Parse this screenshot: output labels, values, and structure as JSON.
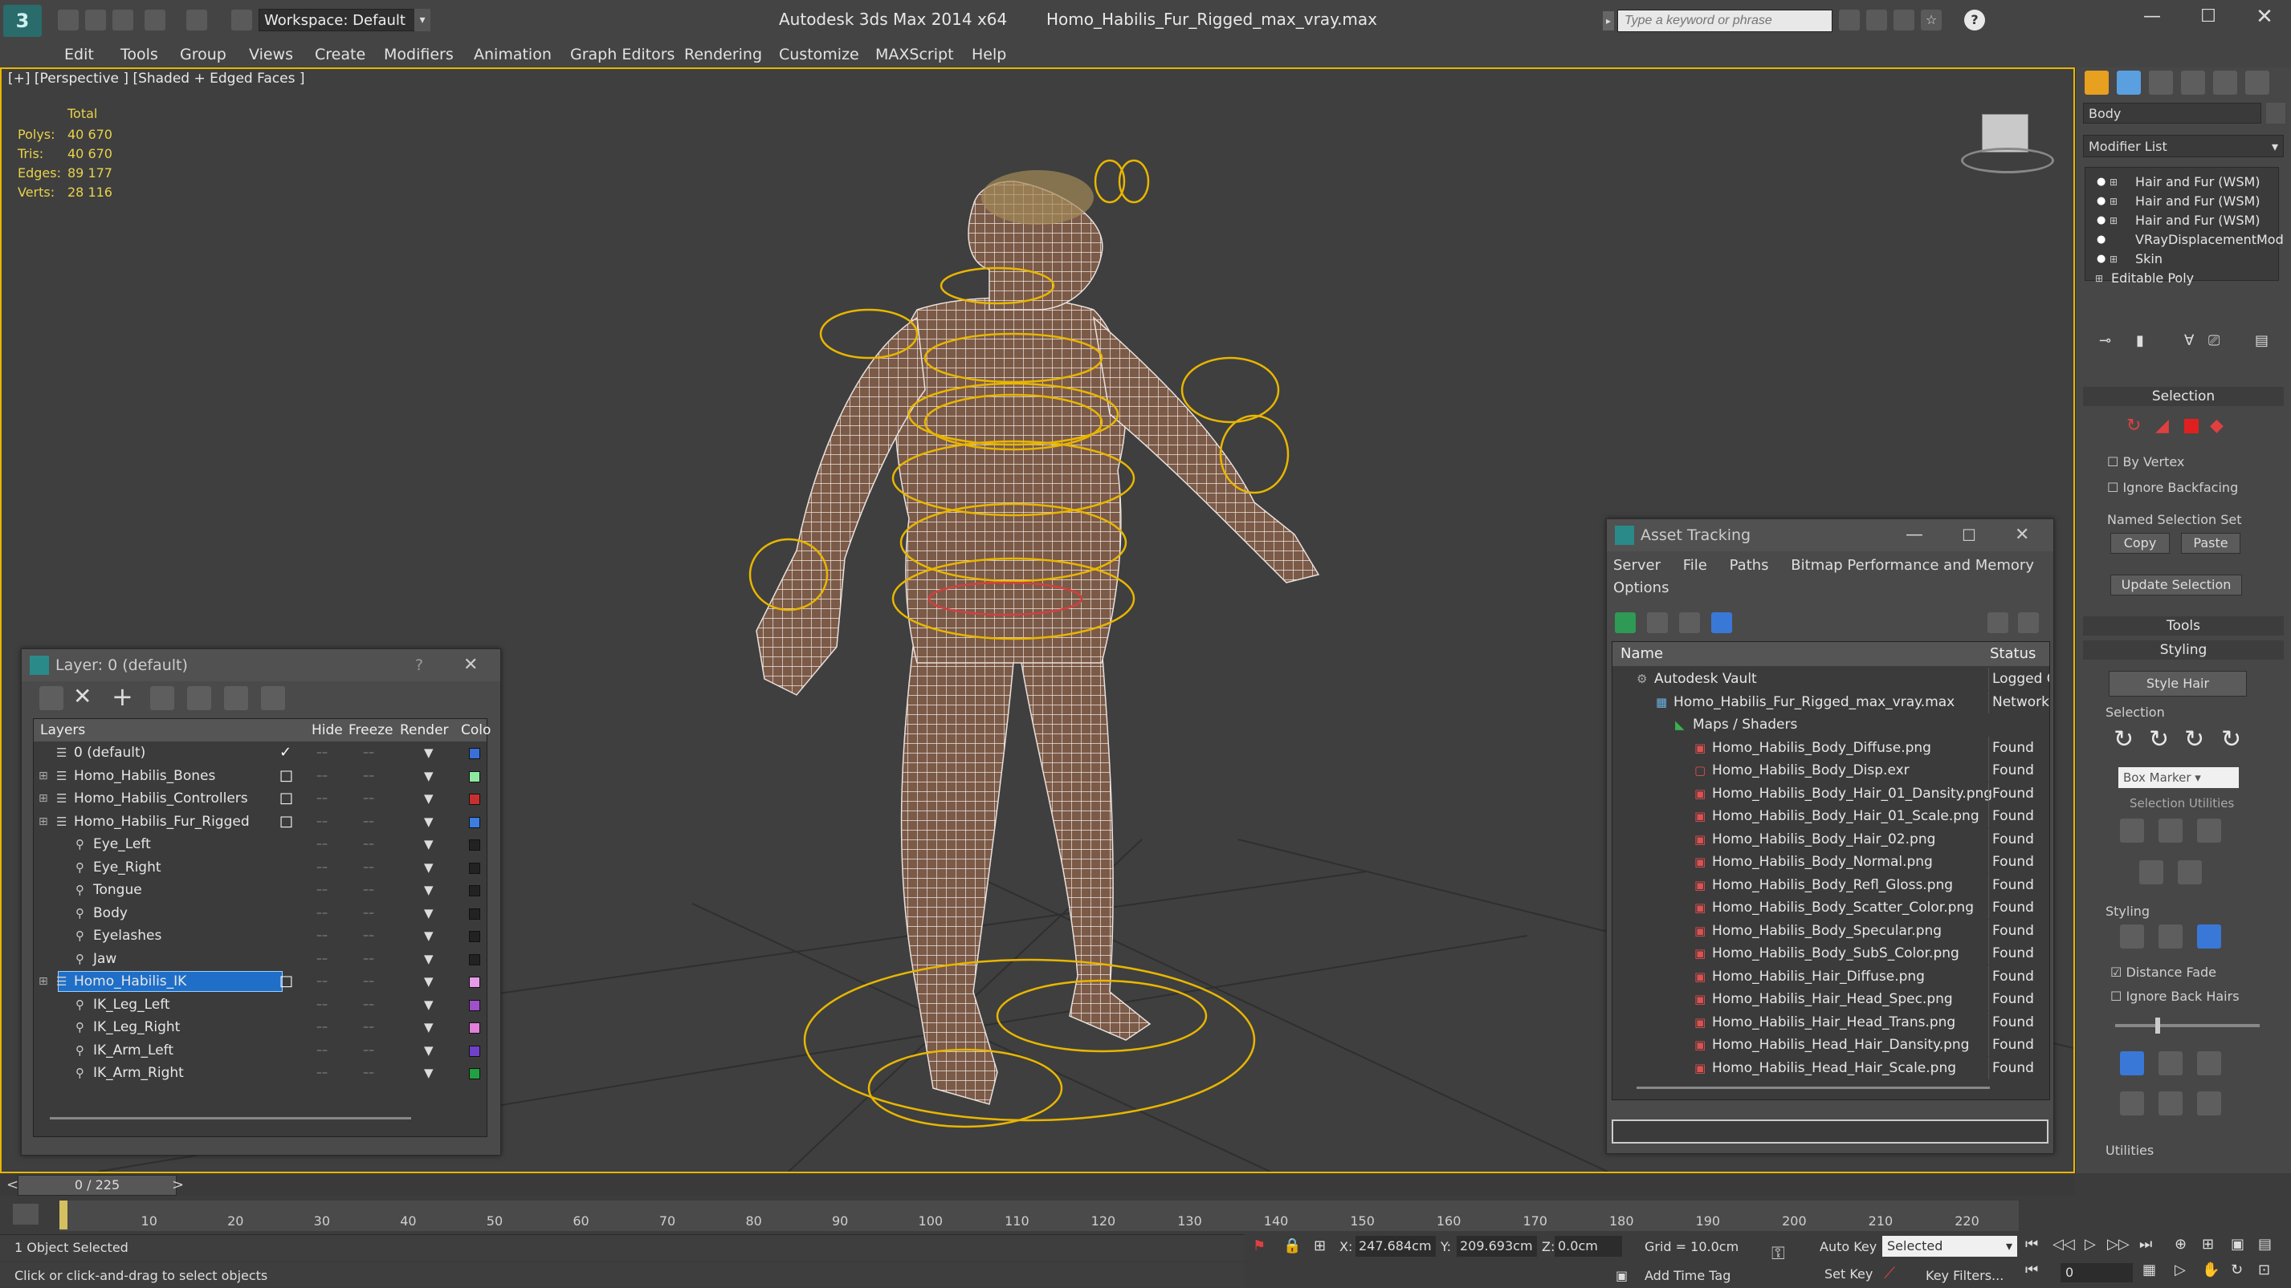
{
  "title": {
    "app": "Autodesk 3ds Max  2014 x64",
    "file": "Homo_Habilis_Fur_Rigged_max_vray.max",
    "workspace": "Workspace: Default",
    "search_placeholder": "Type a keyword or phrase"
  },
  "menu": [
    "Edit",
    "Tools",
    "Group",
    "Views",
    "Create",
    "Modifiers",
    "Animation",
    "Graph Editors",
    "Rendering",
    "Customize",
    "MAXScript",
    "Help"
  ],
  "viewport": {
    "label": "[+] [Perspective ] [Shaded + Edged Faces ]",
    "stats_header": "Total",
    "stats": [
      {
        "label": "Polys:",
        "value": "40 670"
      },
      {
        "label": "Tris:",
        "value": "40 670"
      },
      {
        "label": "Edges:",
        "value": "89 177"
      },
      {
        "label": "Verts:",
        "value": "28 116"
      }
    ]
  },
  "layer_dialog": {
    "title": "Layer: 0 (default)",
    "help": "?",
    "columns": [
      "Layers",
      "Hide",
      "Freeze",
      "Render",
      "Colo"
    ],
    "rows": [
      {
        "name": "0 (default)",
        "indent": 0,
        "color": "#3a6fd8",
        "check": "✓"
      },
      {
        "name": "Homo_Habilis_Bones",
        "indent": 0,
        "color": "#8fe8a0",
        "check": "□"
      },
      {
        "name": "Homo_Habilis_Controllers",
        "indent": 0,
        "color": "#c83030",
        "check": "□"
      },
      {
        "name": "Homo_Habilis_Fur_Rigged",
        "indent": 0,
        "color": "#3a7ee0",
        "check": "□"
      },
      {
        "name": "Eye_Left",
        "indent": 1,
        "color": "#222222",
        "check": ""
      },
      {
        "name": "Eye_Right",
        "indent": 1,
        "color": "#222222",
        "check": ""
      },
      {
        "name": "Tongue",
        "indent": 1,
        "color": "#222222",
        "check": ""
      },
      {
        "name": "Body",
        "indent": 1,
        "color": "#222222",
        "check": ""
      },
      {
        "name": "Eyelashes",
        "indent": 1,
        "color": "#222222",
        "check": ""
      },
      {
        "name": "Jaw",
        "indent": 1,
        "color": "#222222",
        "check": ""
      },
      {
        "name": "Homo_Habilis_IK",
        "indent": 0,
        "color": "#e59be8",
        "check": "□",
        "selected": true
      },
      {
        "name": "IK_Leg_Left",
        "indent": 1,
        "color": "#a050c8",
        "check": ""
      },
      {
        "name": "IK_Leg_Right",
        "indent": 1,
        "color": "#e080d8",
        "check": ""
      },
      {
        "name": "IK_Arm_Left",
        "indent": 1,
        "color": "#7040c8",
        "check": ""
      },
      {
        "name": "IK_Arm_Right",
        "indent": 1,
        "color": "#20a040",
        "check": ""
      }
    ]
  },
  "asset_dialog": {
    "title": "Asset Tracking",
    "menu": [
      "Server",
      "File",
      "Paths",
      "Bitmap Performance and Memory",
      "Options"
    ],
    "columns": [
      "Name",
      "Status"
    ],
    "rows": [
      {
        "name": "Autodesk Vault",
        "status": "Logged O",
        "indent": 0
      },
      {
        "name": "Homo_Habilis_Fur_Rigged_max_vray.max",
        "status": "Network",
        "indent": 1
      },
      {
        "name": "Maps / Shaders",
        "status": "",
        "indent": 2
      },
      {
        "name": "Homo_Habilis_Body_Diffuse.png",
        "status": "Found",
        "indent": 3
      },
      {
        "name": "Homo_Habilis_Body_Disp.exr",
        "status": "Found",
        "indent": 3
      },
      {
        "name": "Homo_Habilis_Body_Hair_01_Dansity.png",
        "status": "Found",
        "indent": 3
      },
      {
        "name": "Homo_Habilis_Body_Hair_01_Scale.png",
        "status": "Found",
        "indent": 3
      },
      {
        "name": "Homo_Habilis_Body_Hair_02.png",
        "status": "Found",
        "indent": 3
      },
      {
        "name": "Homo_Habilis_Body_Normal.png",
        "status": "Found",
        "indent": 3
      },
      {
        "name": "Homo_Habilis_Body_Refl_Gloss.png",
        "status": "Found",
        "indent": 3
      },
      {
        "name": "Homo_Habilis_Body_Scatter_Color.png",
        "status": "Found",
        "indent": 3
      },
      {
        "name": "Homo_Habilis_Body_Specular.png",
        "status": "Found",
        "indent": 3
      },
      {
        "name": "Homo_Habilis_Body_SubS_Color.png",
        "status": "Found",
        "indent": 3
      },
      {
        "name": "Homo_Habilis_Hair_Diffuse.png",
        "status": "Found",
        "indent": 3
      },
      {
        "name": "Homo_Habilis_Hair_Head_Spec.png",
        "status": "Found",
        "indent": 3
      },
      {
        "name": "Homo_Habilis_Hair_Head_Trans.png",
        "status": "Found",
        "indent": 3
      },
      {
        "name": "Homo_Habilis_Head_Hair_Dansity.png",
        "status": "Found",
        "indent": 3
      },
      {
        "name": "Homo_Habilis_Head_Hair_Scale.png",
        "status": "Found",
        "indent": 3
      }
    ]
  },
  "cmd_panel": {
    "object_name": "Body",
    "modifier_list": "Modifier List",
    "stack": [
      "Hair and Fur (WSM)",
      "Hair and Fur (WSM)",
      "Hair and Fur (WSM)",
      "VRayDisplacementMod",
      "Skin",
      "Editable Poly"
    ],
    "selection_header": "Selection",
    "by_vertex": "By Vertex",
    "ignore_backfacing": "Ignore Backfacing",
    "named_selection": "Named Selection Set",
    "copy": "Copy",
    "paste": "Paste",
    "update_selection": "Update Selection",
    "tools": "Tools",
    "styling": "Styling",
    "style_hair": "Style Hair",
    "selection_sub": "Selection",
    "box_marker": "Box Marker",
    "selection_utilities": "Selection Utilities",
    "styling_sub": "Styling",
    "distance_fade": "Distance Fade",
    "ignore_back_hairs": "Ignore Back Hairs",
    "utilities": "Utilities"
  },
  "timeline": {
    "frame": "0 / 225",
    "ticks": [
      10,
      20,
      30,
      40,
      50,
      60,
      70,
      80,
      90,
      100,
      110,
      120,
      130,
      140,
      150,
      160,
      170,
      180,
      190,
      200,
      210,
      220
    ]
  },
  "status": {
    "selected": "1 Object Selected",
    "hint": "Click or click-and-drag to select objects",
    "x_label": "X:",
    "x": "247.684cm",
    "y_label": "Y:",
    "y": "209.693cm",
    "z_label": "Z:",
    "z": "0.0cm",
    "grid": "Grid = 10.0cm",
    "add_time_tag": "Add Time Tag",
    "auto_key": "Auto Key",
    "set_key": "Set Key",
    "selected_dd": "Selected",
    "key_filters": "Key Filters...",
    "frame_field": "0"
  }
}
